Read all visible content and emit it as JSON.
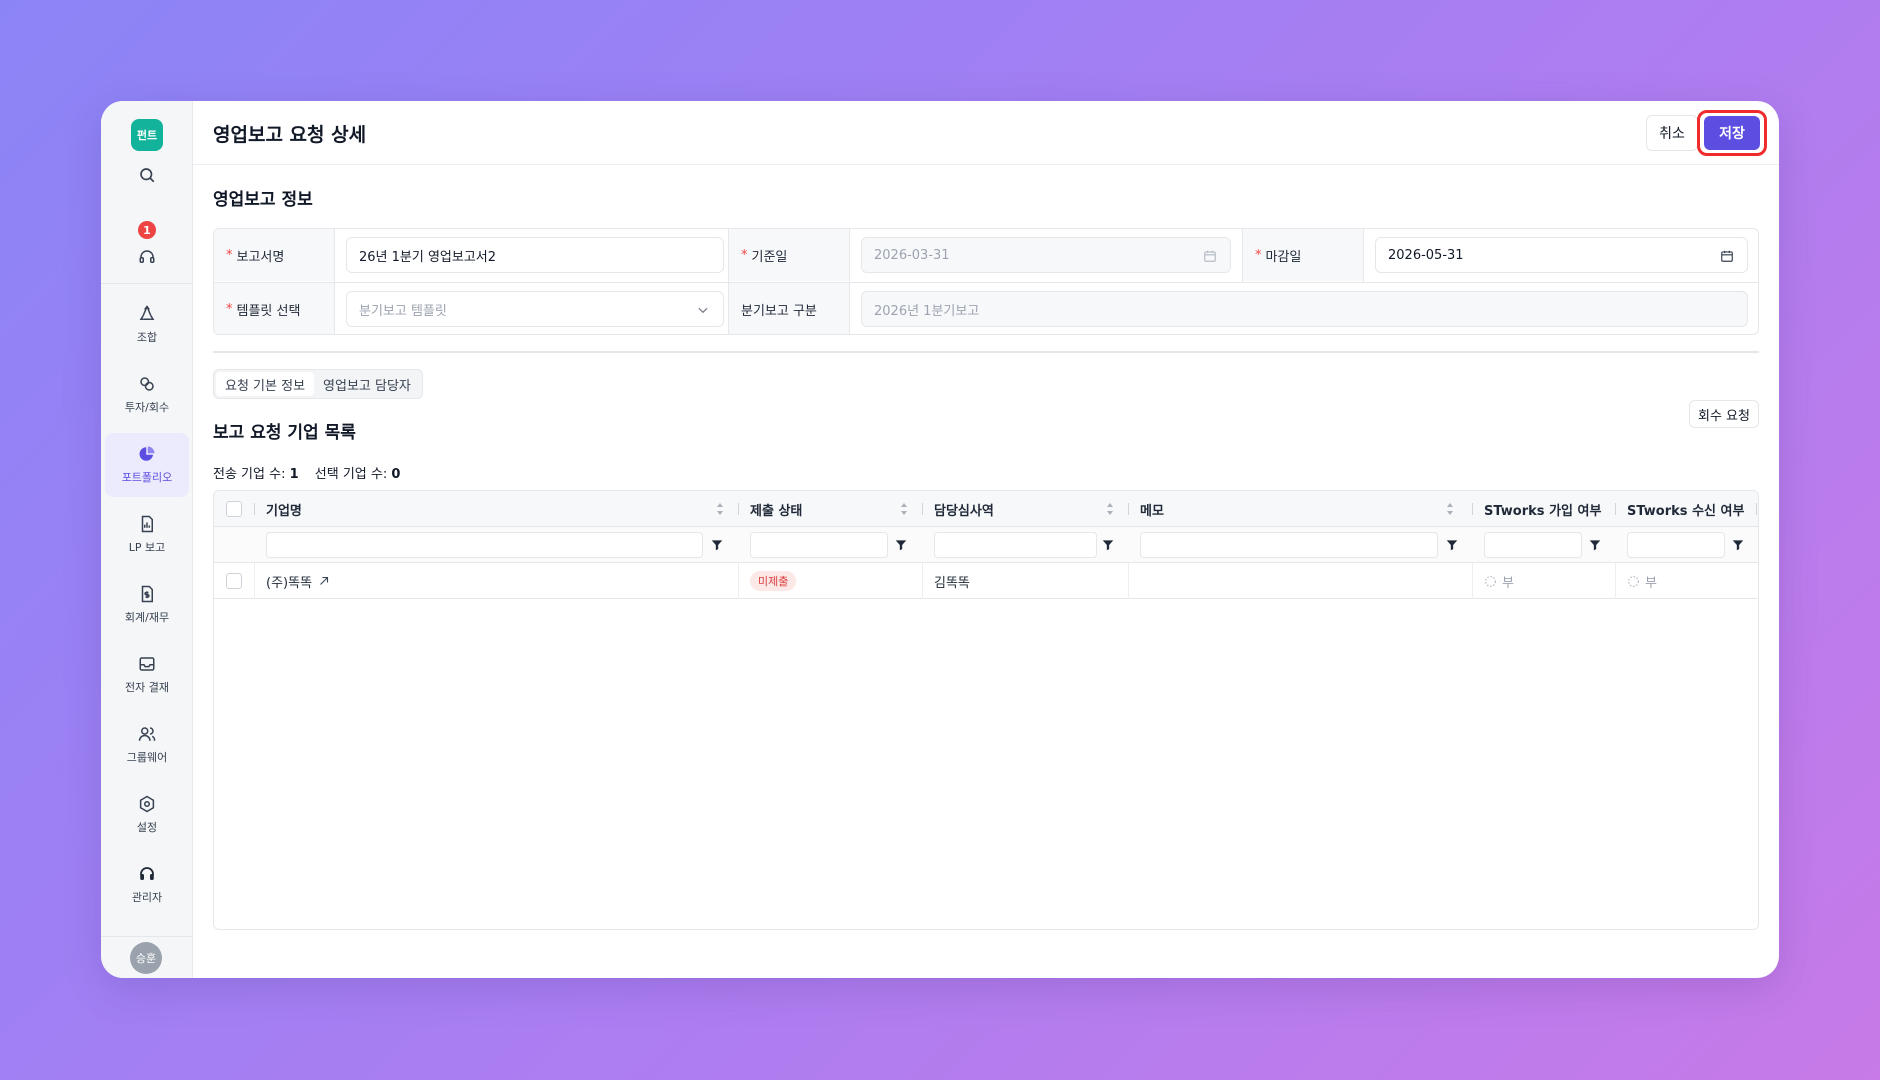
{
  "sidebar": {
    "logo": "펀트",
    "notification_count": "1",
    "items": [
      {
        "label": "조합",
        "icon": "recycle-icon"
      },
      {
        "label": "투자/회수",
        "icon": "investment-icon"
      },
      {
        "label": "포트폴리오",
        "icon": "pie-chart-icon",
        "active": true
      },
      {
        "label": "LP 보고",
        "icon": "report-icon"
      },
      {
        "label": "회계/재무",
        "icon": "finance-doc-icon"
      },
      {
        "label": "전자 결재",
        "icon": "inbox-icon"
      },
      {
        "label": "그룹웨어",
        "icon": "users-icon"
      },
      {
        "label": "설정",
        "icon": "settings-icon"
      },
      {
        "label": "관리자",
        "icon": "admin-headset-icon"
      }
    ],
    "avatar": "승훈"
  },
  "header": {
    "title": "영업보고 요청 상세",
    "cancel_label": "취소",
    "save_label": "저장"
  },
  "info_section": {
    "title": "영업보고 정보",
    "report_name_label": "보고서명",
    "report_name_value": "26년 1분기 영업보고서2",
    "base_date_label": "기준일",
    "base_date_value": "2026-03-31",
    "deadline_label": "마감일",
    "deadline_value": "2026-05-31",
    "template_label": "템플릿 선택",
    "template_placeholder": "분기보고 템플릿",
    "quarter_label": "분기보고 구분",
    "quarter_value": "2026년 1분기보고"
  },
  "tabs": [
    "요청 기본 정보",
    "영업보고 담당자"
  ],
  "list_section": {
    "title": "보고 요청 기업 목록",
    "recall_button": "회수 요청",
    "sent_label": "전송 기업 수:",
    "sent_count": "1",
    "selected_label": "선택 기업 수:",
    "selected_count": "0"
  },
  "table": {
    "columns": [
      "기업명",
      "제출 상태",
      "담당심사역",
      "메모",
      "STworks 가입 여부",
      "STworks 수신 여부"
    ],
    "rows": [
      {
        "company": "(주)똑똑",
        "status": "미제출",
        "reviewer": "김똑똑",
        "memo": "",
        "joined": "부",
        "received": "부"
      }
    ]
  },
  "colors": {
    "accent": "#5b4ee0",
    "highlight_ring": "#ef2b2b",
    "logo_bg": "#13b39b",
    "status_badge_bg": "#fde8e8",
    "status_badge_text": "#dc3b3b"
  }
}
